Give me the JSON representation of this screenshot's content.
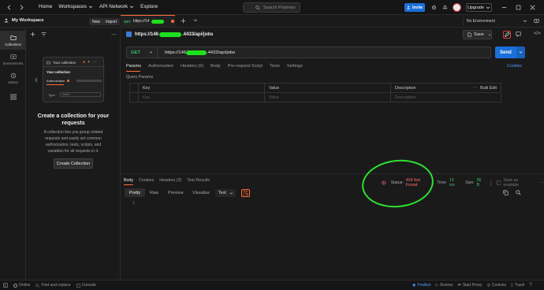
{
  "topbar": {
    "nav": [
      "Home",
      "Workspaces",
      "API Network",
      "Explore"
    ],
    "search_placeholder": "Search Postman",
    "invite_label": "Invite",
    "upgrade_label": "Upgrade"
  },
  "workspace": {
    "name": "My Workspace",
    "new_label": "New",
    "import_label": "Import"
  },
  "request_tab": {
    "method": "GET",
    "title": "https://14"
  },
  "environment": {
    "selected": "No Environment"
  },
  "rail": {
    "items": [
      {
        "label": "Collections",
        "icon": "collections-icon"
      },
      {
        "label": "Environments",
        "icon": "environments-icon"
      },
      {
        "label": "History",
        "icon": "history-icon"
      },
      {
        "label": "",
        "icon": "grid-icon"
      }
    ]
  },
  "empty_state": {
    "card_title": "Your collection",
    "card_subtitle": "Your collection",
    "card_row1": "Authorization",
    "card_row2_label": "Type",
    "card_row2_value": "Inherit",
    "title": "Create a collection for your requests",
    "description": "A collection lets you group related requests and easily set common authorization, tests, scripts, and variables for all requests in it.",
    "button": "Create Collection"
  },
  "request": {
    "breadcrumb_start": "https://146",
    "breadcrumb_end": ".4433/api/jobs",
    "save_label": "Save",
    "method": "GET",
    "url_start": "https://146",
    "url_end": ".4433/api/jobs",
    "send_label": "Send",
    "cookies_label": "Cookies",
    "tabs": [
      "Params",
      "Authorization",
      "Headers (6)",
      "Body",
      "Pre-request Script",
      "Tests",
      "Settings"
    ],
    "query_params_label": "Query Params",
    "columns": [
      "Key",
      "Value",
      "Description"
    ],
    "bulk_edit": "Bulk Edit",
    "placeholders": [
      "Key",
      "Value",
      "Description"
    ]
  },
  "response": {
    "tabs": [
      "Body",
      "Cookies",
      "Headers (3)",
      "Test Results"
    ],
    "status_label": "Status:",
    "status_code": "404 Not Found",
    "time_label": "Time:",
    "time_value": "13 ms",
    "size_label": "Size:",
    "size_value": "86 B",
    "save_example": "Save as example",
    "view_modes": [
      "Pretty",
      "Raw",
      "Preview",
      "Visualize"
    ],
    "format": "Text",
    "line_number": "1"
  },
  "bottombar": {
    "left": [
      "Online",
      "Find and replace",
      "Console"
    ],
    "right": [
      "Postbot",
      "Runner",
      "Start Proxy",
      "Cookies",
      "Trash"
    ]
  },
  "colors": {
    "accent": "#ff6c37",
    "primary": "#1b6fd8",
    "status_error": "#ff6b6b",
    "status_ok": "#3dbf6b",
    "annotation": "#2fe02f"
  }
}
